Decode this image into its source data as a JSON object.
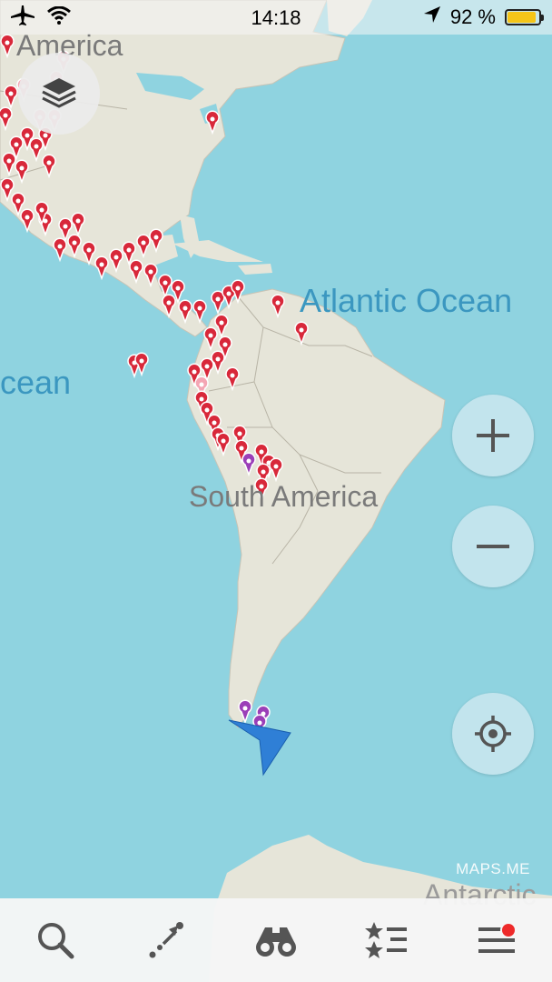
{
  "status_bar": {
    "time": "14:18",
    "battery_percent": "92 %",
    "battery_level": 0.92,
    "icons": [
      "airplane-icon",
      "wifi-icon",
      "location-arrow-icon",
      "battery-icon"
    ]
  },
  "map": {
    "labels": {
      "north_america": "America",
      "atlantic": "Atlantic Ocean",
      "pacific": "cean",
      "south_america": "South America",
      "antarctica": "Antarctic"
    },
    "watermark": "MAPS.ME",
    "colors": {
      "water": "#8fd3e0",
      "land": "#e6e5d9",
      "pin_red": "#d8283a",
      "pin_pink": "#f4a6b4",
      "pin_purple": "#9b3fb8",
      "location_arrow": "#2f7fd6"
    }
  },
  "controls": {
    "layers": "layers-icon",
    "zoom_in": "plus-icon",
    "zoom_out": "minus-icon",
    "my_position": "crosshair-icon"
  },
  "bottom_bar": {
    "tabs": [
      "search-icon",
      "route-icon",
      "discovery-binoculars-icon",
      "bookmarks-icon",
      "menu-icon"
    ],
    "menu_badge": true
  }
}
